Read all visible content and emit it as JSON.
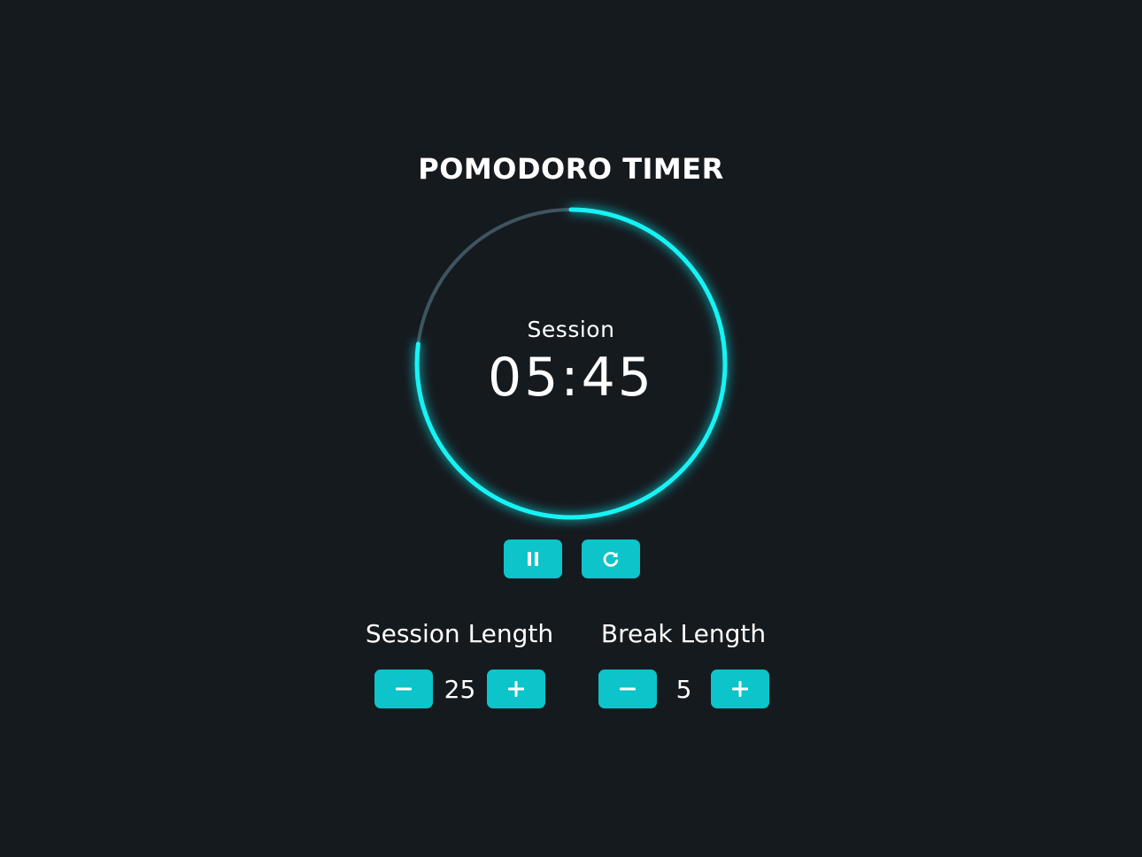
{
  "app": {
    "title": "POMODORO TIMER"
  },
  "timer": {
    "mode": "Session",
    "time": "05:45",
    "progress_remaining": 0.77,
    "colors": {
      "progress": "#14f3f5",
      "track": "#3e5561",
      "background": "#151a1f"
    }
  },
  "controls": {
    "pause_icon": "pause-icon",
    "reset_icon": "refresh-icon",
    "button_color": "#0cc4c9"
  },
  "session": {
    "label": "Session Length",
    "value": "25",
    "decrement_icon": "minus-icon",
    "increment_icon": "plus-icon"
  },
  "break": {
    "label": "Break Length",
    "value": "5",
    "decrement_icon": "minus-icon",
    "increment_icon": "plus-icon"
  }
}
